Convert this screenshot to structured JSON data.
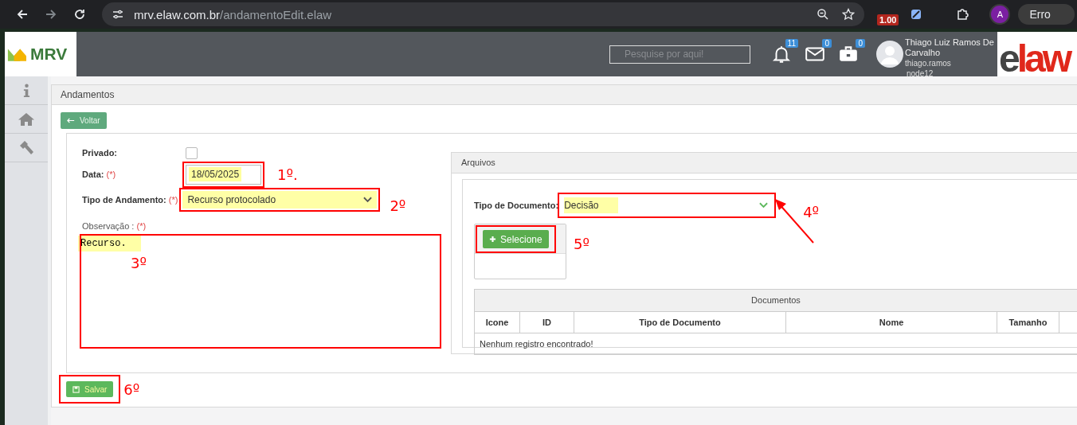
{
  "browser": {
    "url_host": "mrv.elaw.com.br",
    "url_path": "/andamentoEdit.elaw",
    "extension_badge": "1.00",
    "profile": "A",
    "error_button": "Erro"
  },
  "header": {
    "logo": "MRV",
    "search": {
      "placeholder": "Pesquise por aqui!"
    },
    "notifications": [
      {
        "kind": "bell",
        "count": "11"
      },
      {
        "kind": "mail",
        "count": "0"
      },
      {
        "kind": "briefcase",
        "count": "0"
      }
    ],
    "user": {
      "name": "Thiago Luiz Ramos De Carvalho",
      "login": "thiago.ramos",
      "node": "node12"
    },
    "brand": "elaw"
  },
  "sidebar": [
    {
      "kind": "info"
    },
    {
      "kind": "home"
    },
    {
      "kind": "gavel"
    }
  ],
  "panel": {
    "title": "Andamentos",
    "back_button": "Voltar",
    "form": {
      "private": {
        "label": "Privado:",
        "checked": false
      },
      "date": {
        "label": "Data:",
        "required": "(*)",
        "value": "18/05/2025",
        "annotation": "1º."
      },
      "type": {
        "label": "Tipo de Andamento:",
        "required": "(*)",
        "value": "Recurso protocolado",
        "annotation": "2º"
      },
      "observation": {
        "label": "Observação :",
        "required": "(*)",
        "value": "Recurso.",
        "annotation": "3º"
      }
    },
    "files": {
      "title": "Arquivos",
      "doc_type": {
        "label": "Tipo de Documento:",
        "value": "Decisão",
        "annotation": "4º",
        "arrow": true
      },
      "select_button": {
        "label": "Selecione",
        "annotation": "5º"
      },
      "table": {
        "caption": "Documentos",
        "columns": [
          "Icone",
          "ID",
          "Tipo de Documento",
          "Nome",
          "Tamanho"
        ],
        "empty": "Nenhum registro encontrado!"
      }
    },
    "save_button": {
      "label": "Salvar",
      "annotation": "6º"
    }
  }
}
